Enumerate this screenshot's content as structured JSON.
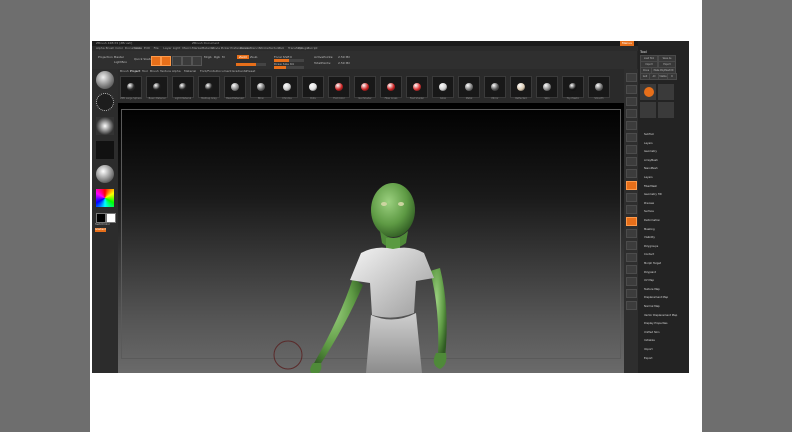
{
  "window": {
    "title_left": "ZBrush 4R8 P2 [ZBrush]",
    "title_mid": "ZBrush Document",
    "title_right": "Menus",
    "tab_a": "QuickSave",
    "tab_b": "Tool"
  },
  "menubar": [
    "Alpha",
    "Brush",
    "Color",
    "Document",
    "Draw",
    "Edit",
    "File",
    "Layer",
    "Light",
    "Macro",
    "Marker",
    "Material",
    "Movie",
    "Picker",
    "Preferences",
    "Render",
    "Stencil",
    "Stroke",
    "Texture",
    "Tool",
    "Transform",
    "Zplugin",
    "Zscript"
  ],
  "toolbar": {
    "projection_master": "Projection Master",
    "lightbox": "LightBox",
    "quick_sketch": "Quick Sketch",
    "edit": "Edit",
    "draw": "Draw",
    "move": "Move",
    "scale": "Scale",
    "rotate": "Rotate",
    "mrgb": "Mrgb",
    "rgb": "Rgb",
    "m": "M",
    "zadd": "Zadd",
    "zsub": "Zsub",
    "focal_shift_label": "Focal Shift",
    "focal_shift_value": "0",
    "draw_size_label": "Draw Size",
    "draw_size_value": "64",
    "active_points_label": "ActivePoints:",
    "active_points_value": "2.59 Mil",
    "total_points_label": "TotalPoints:",
    "total_points_value": "2.59 Mil"
  },
  "materials": {
    "tabs": [
      "Brush",
      "Project",
      "Tool",
      "Brush",
      "Texture",
      "Alpha",
      "Material",
      "Font/Fonts",
      "Document",
      "Gradients",
      "Preset"
    ],
    "selected_tab_index": 1,
    "items": [
      {
        "label": "ZPR Large Sphere",
        "color": "#2a2a2a"
      },
      {
        "label": "Basic Material",
        "color": "#1f1f1f"
      },
      {
        "label": "Light Material",
        "color": "#1f1f1f"
      },
      {
        "label": "MatCap Gray",
        "color": "#1f1f1f"
      },
      {
        "label": "BasicMaterial2",
        "color": "#8a8a8a"
      },
      {
        "label": "Blinn",
        "color": "#6b6b6b"
      },
      {
        "label": "Chrome",
        "color": "#c9c9c9"
      },
      {
        "label": "Dots",
        "color": "#e0e0e0"
      },
      {
        "label": "Flat Color",
        "color": "#cc2222"
      },
      {
        "label": "Gel Shader",
        "color": "#cc2222"
      },
      {
        "label": "Fiber Lines",
        "color": "#cc2222"
      },
      {
        "label": "Fast Shader",
        "color": "#dd3333"
      },
      {
        "label": "Glow",
        "color": "#cfcfcf"
      },
      {
        "label": "Metal",
        "color": "#7a7a7a"
      },
      {
        "label": "Mirror",
        "color": "#555555"
      },
      {
        "label": "Reflected",
        "color": "#d8c8b0"
      },
      {
        "label": "Skin",
        "color": "#8a8a8a"
      },
      {
        "label": "Toy Plastic",
        "color": "#151515"
      },
      {
        "label": "Smooth",
        "color": "#6a6a6a"
      }
    ]
  },
  "tray": {
    "header": "Tool",
    "buttons": [
      "Load Tool",
      "Save As",
      "Import",
      "Export",
      "Clone",
      "Make PolyMesh3D",
      "GoZ",
      "All",
      "Visible",
      "R"
    ],
    "items": [
      "SubTool",
      "Layers",
      "Geometry",
      "ArrayMesh",
      "NanoMesh",
      "Layers",
      "FiberMesh",
      "Geometry HD",
      "Preview",
      "Surface",
      "Deformation",
      "Masking",
      "Visibility",
      "Polygroups",
      "Contact",
      "Morph Target",
      "Polypaint",
      "UV Map",
      "Texture Map",
      "Displacement Map",
      "Normal Map",
      "Vector Displacement Map",
      "Display Properties",
      "Unified Skin",
      "Initialize",
      "Import",
      "Export"
    ]
  },
  "left_shelf": {
    "current_color_label": "SwitchColor",
    "alpha_label": "Gradient"
  }
}
